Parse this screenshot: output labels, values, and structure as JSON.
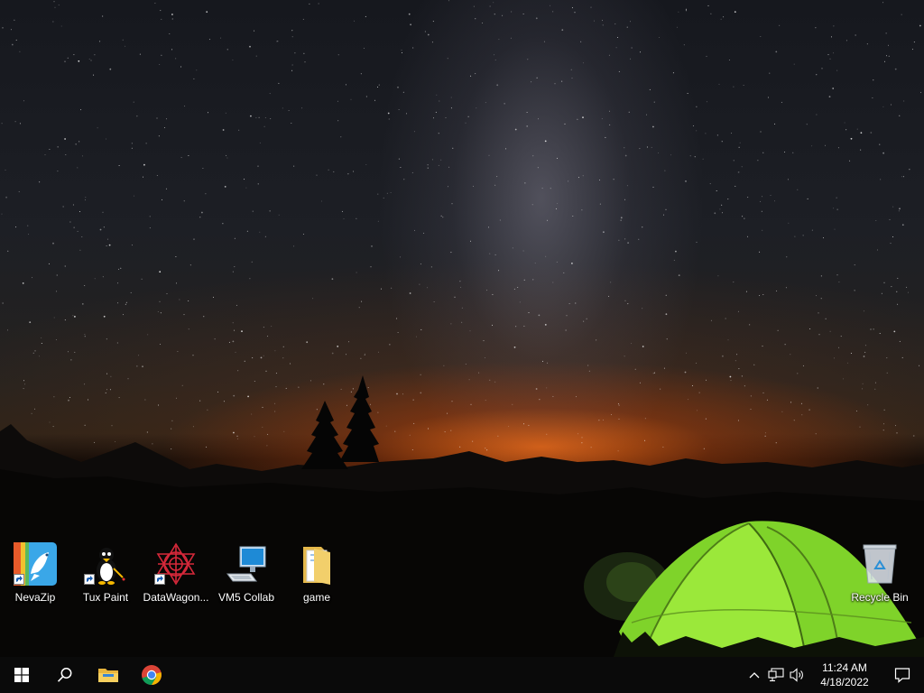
{
  "desktop": {
    "icons": [
      {
        "label": "NevaZip"
      },
      {
        "label": "Tux Paint"
      },
      {
        "label": "DataWagon..."
      },
      {
        "label": "VM5 Collab"
      },
      {
        "label": "game"
      },
      {
        "label": "Recycle Bin"
      }
    ]
  },
  "taskbar": {
    "start_icon": "windows-logo-icon",
    "search_icon": "search-icon",
    "pinned": [
      "file-explorer-icon",
      "chrome-icon"
    ],
    "tray": {
      "icons": [
        "chevron-up-icon",
        "network-icon",
        "volume-icon"
      ],
      "time": "11:24 AM",
      "date": "4/18/2022",
      "notification_icon": "notification-icon"
    }
  },
  "colors": {
    "taskbar_bg": "#0a0a0a",
    "horizon_glow": "#f06914",
    "tent_green": "#8be02a"
  }
}
